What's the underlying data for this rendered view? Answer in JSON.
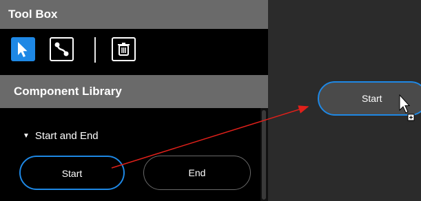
{
  "toolbox": {
    "title": "Tool Box",
    "tools": [
      {
        "name": "select",
        "icon": "cursor-arrow-icon",
        "active": true
      },
      {
        "name": "connector",
        "icon": "connector-line-icon",
        "active": false
      },
      {
        "name": "delete",
        "icon": "trash-icon",
        "active": false
      }
    ]
  },
  "library": {
    "title": "Component Library",
    "section": {
      "label": "Start and End",
      "expanded": true
    },
    "components": [
      {
        "label": "Start",
        "selected": true
      },
      {
        "label": "End",
        "selected": false
      }
    ]
  },
  "canvas": {
    "node": {
      "label": "Start"
    }
  },
  "colors": {
    "accent": "#1e88e5",
    "panel_header": "#6a6a6a",
    "drag_arrow": "#e0201a"
  }
}
